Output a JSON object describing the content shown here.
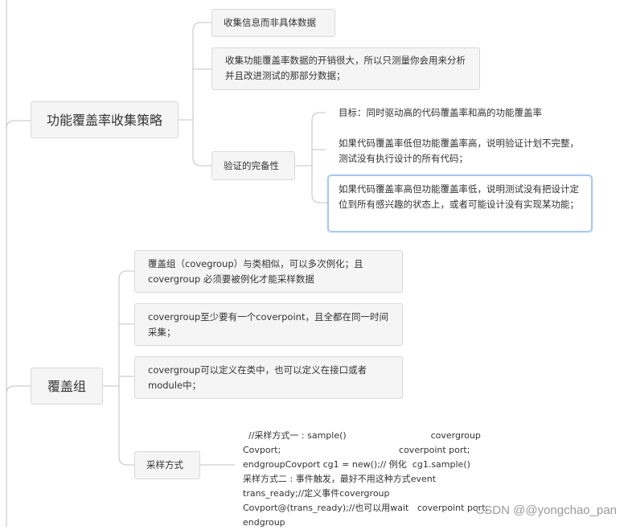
{
  "nodes": {
    "strategy": {
      "title": "功能覆盖率收集策略",
      "child1": "收集信息而非具体数据",
      "child2": "收集功能覆盖率数据的开销很大，所以只测量你会用来分析并且改进测试的那部分数据；",
      "completeness": {
        "label": "验证的完备性",
        "item1": "目标：同时驱动高的代码覆盖率和高的功能覆盖率",
        "item2": "如果代码覆盖率低但功能覆盖率高，说明验证计划不完整，测试没有执行设计的所有代码；",
        "item3": "如果代码覆盖率高但功能覆盖率低，说明测试没有把设计定位到所有感兴趣的状态上，或者可能设计没有实现某功能；"
      }
    },
    "covergroup": {
      "title": "覆盖组",
      "child1": "覆盖组（covegroup）与类相似，可以多次例化；且covergroup 必须要被例化才能采样数据",
      "child2": "covergroup至少要有一个coverpoint，且全都在同一时间采集；",
      "child3": "covergroup可以定义在类中，也可以定义在接口或者module中；",
      "sampling": {
        "label": "采样方式",
        "code": "//采样方式一 : sample()                              covergroup\nCovport;                                          coverpoint port;\nendgroupCovport cg1 = new();// 例化  cg1.sample()\n采样方式二 : 事件触发，最好不用这种方式event\ntrans_ready;//定义事件covergroup\nCovport@(trans_ready);//也可以用wait   coverpoint port;\nendgroup"
      }
    }
  },
  "watermark": "CSDN @@yongchao_pan",
  "colors": {
    "node_bg": "#f5f5f5",
    "node_border": "#d9d9d9",
    "selected_border": "#a9c7ef",
    "connector": "#cfcfcf"
  }
}
